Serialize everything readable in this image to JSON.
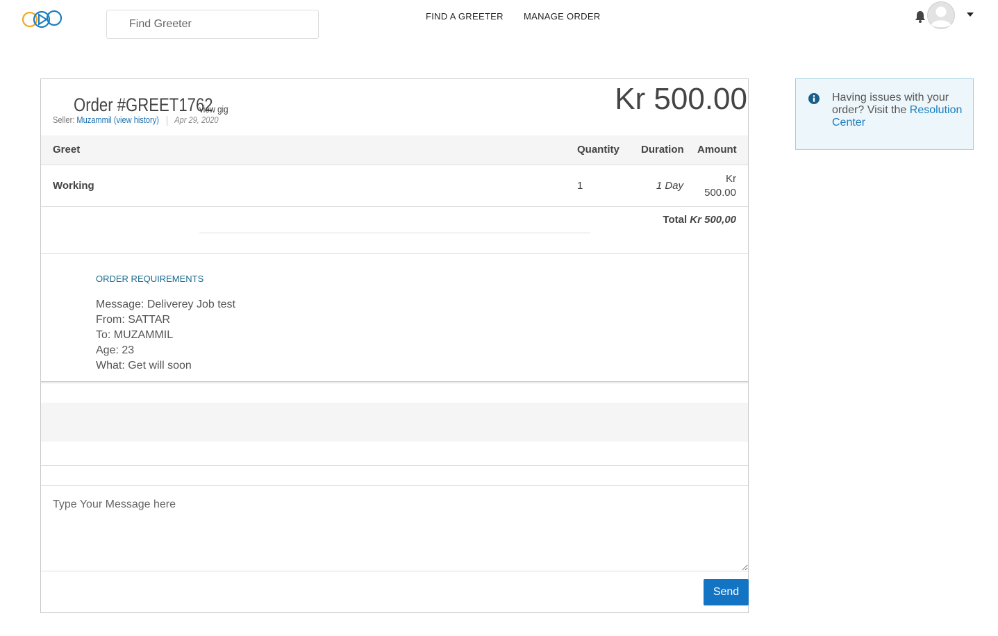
{
  "header": {
    "search_placeholder": "Find Greeter",
    "nav": {
      "find_greeter": "FIND A GREETER",
      "manage_order": "MANAGE ORDER"
    }
  },
  "order": {
    "title": "Order #GREET1762",
    "view_gig": "view gig",
    "seller_label": "Seller:",
    "seller_name": "Muzammil",
    "view_history": "(view history)",
    "date": "Apr 29, 2020",
    "price": "Kr 500.00",
    "table": {
      "headers": {
        "greet": "Greet",
        "quantity": "Quantity",
        "duration": "Duration",
        "amount": "Amount"
      },
      "rows": [
        {
          "greet": "Working",
          "quantity": "1",
          "duration": "1 Day",
          "amount_line1": "Kr",
          "amount_line2": "500.00"
        }
      ],
      "total_label": "Total",
      "total_value": "Kr 500,00"
    },
    "requirements": {
      "title": "ORDER REQUIREMENTS",
      "lines": [
        "Message: Deliverey Job test",
        "From: SATTAR",
        "To: MUZAMMIL",
        "Age: 23",
        "What: Get will soon"
      ]
    },
    "message_placeholder": "Type Your Message here",
    "send_label": "Send"
  },
  "info": {
    "text": "Having issues with your order? Visit the ",
    "link": "Resolution Center"
  },
  "colors": {
    "accent": "#1474c4",
    "link": "#1a7dbf",
    "info_bg": "#edf6fa",
    "logo_orange": "#f5a623",
    "logo_blue": "#1a7dbf"
  }
}
